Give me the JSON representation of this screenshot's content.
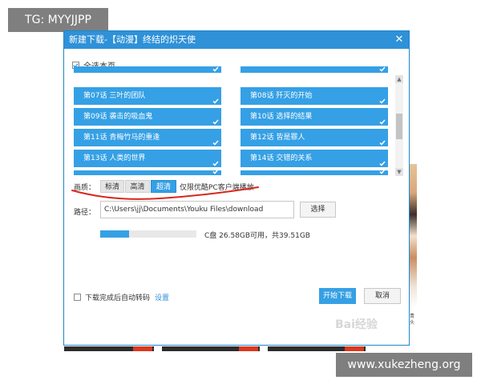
{
  "overlays": {
    "tg": "TG: MYYJJPP",
    "watermark": "www.xukezheng.org",
    "baidu": "Bai经验",
    "side": "青\n头"
  },
  "dialog": {
    "title": "新建下载-【动漫】终结的炽天使",
    "close": "✕",
    "select_all": "全选本页",
    "episodes": [
      {
        "label": "",
        "checked": true
      },
      {
        "label": "",
        "checked": true
      },
      {
        "label": "第07话 三叶的团队",
        "checked": true
      },
      {
        "label": "第08话 歼灭的开始",
        "checked": true
      },
      {
        "label": "第09话 袭击的吸血鬼",
        "checked": true
      },
      {
        "label": "第10话 选择的结果",
        "checked": true
      },
      {
        "label": "第11话 青梅竹马的重逢",
        "checked": true
      },
      {
        "label": "第12话 皆是罪人",
        "checked": true
      },
      {
        "label": "第13话 人类的世界",
        "checked": true
      },
      {
        "label": "第14话 交错的关系",
        "checked": true
      },
      {
        "label": "",
        "checked": true
      },
      {
        "label": "",
        "checked": true
      }
    ],
    "quality": {
      "label": "画质：",
      "options": [
        {
          "label": "标清",
          "selected": false
        },
        {
          "label": "高清",
          "selected": false
        },
        {
          "label": "超清",
          "selected": true
        }
      ],
      "note": "仅限优酷PC客户端播放"
    },
    "path": {
      "label": "路径：",
      "value": "C:\\Users\\jj\\Documents\\Youku Files\\download",
      "choose": "选择"
    },
    "disk": {
      "used_fraction": 0.3,
      "text": "C盘 26.58GB可用，共39.51GB"
    },
    "auto_transcode": {
      "label": "下载完成后自动转码",
      "checked": false,
      "settings": "设置"
    },
    "buttons": {
      "start": "开始下载",
      "cancel": "取消"
    }
  },
  "colors": {
    "accent": "#35a0e5",
    "annotation": "#d8261c"
  }
}
